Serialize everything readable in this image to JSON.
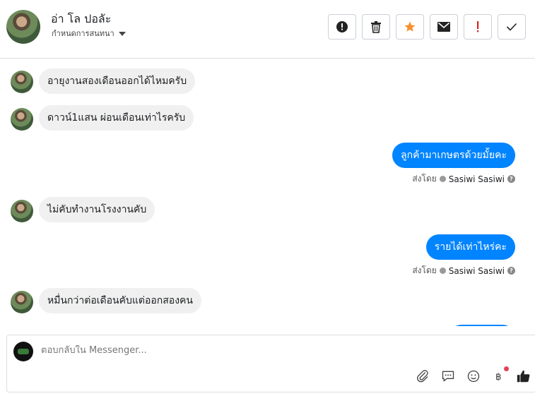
{
  "header": {
    "contact_name": "อ่า โล ปอลัะ",
    "assign_label": "กำหนดการสนทนา",
    "toolbar": [
      {
        "name": "mark-spam-button",
        "icon": "alert-circle-icon"
      },
      {
        "name": "delete-button",
        "icon": "trash-icon"
      },
      {
        "name": "star-button",
        "icon": "star-icon",
        "color": "#f5922f"
      },
      {
        "name": "mark-unread-button",
        "icon": "envelope-icon"
      },
      {
        "name": "important-button",
        "icon": "exclamation-icon",
        "color": "#e02020"
      },
      {
        "name": "mark-done-button",
        "icon": "check-icon"
      }
    ]
  },
  "messages": [
    {
      "direction": "in",
      "text": "อายุงานสองเดือนออกได้ไหมครับ"
    },
    {
      "direction": "in",
      "text": "ดาวน์1แสน ผ่อนเดือนเท่าไรครับ"
    },
    {
      "direction": "out",
      "text": "ลูกค้ามาเกษตรด้วยมั้ยคะ",
      "sent_by_label": "ส่งโดย",
      "sent_by_name": "Sasiwi Sasiwi"
    },
    {
      "direction": "in",
      "text": "ไม่คับทำงานโรงงานคับ"
    },
    {
      "direction": "out",
      "text": "รายได้เท่าไหร่คะ",
      "sent_by_label": "ส่งโดย",
      "sent_by_name": "Sasiwi Sasiwi"
    },
    {
      "direction": "in",
      "text": "หมื่นกว่าต่อเดือนคับแต่ออกสองคน"
    }
  ],
  "composer": {
    "placeholder": "ตอบกลับใน Messenger...",
    "icons": [
      "paperclip-icon",
      "saved-reply-icon",
      "emoji-icon",
      "baht-payment-icon",
      "thumbs-up-icon"
    ]
  },
  "colors": {
    "accent": "#0084ff",
    "incoming_bubble": "#f0f0f0",
    "star": "#f5922f",
    "important": "#e02020"
  }
}
